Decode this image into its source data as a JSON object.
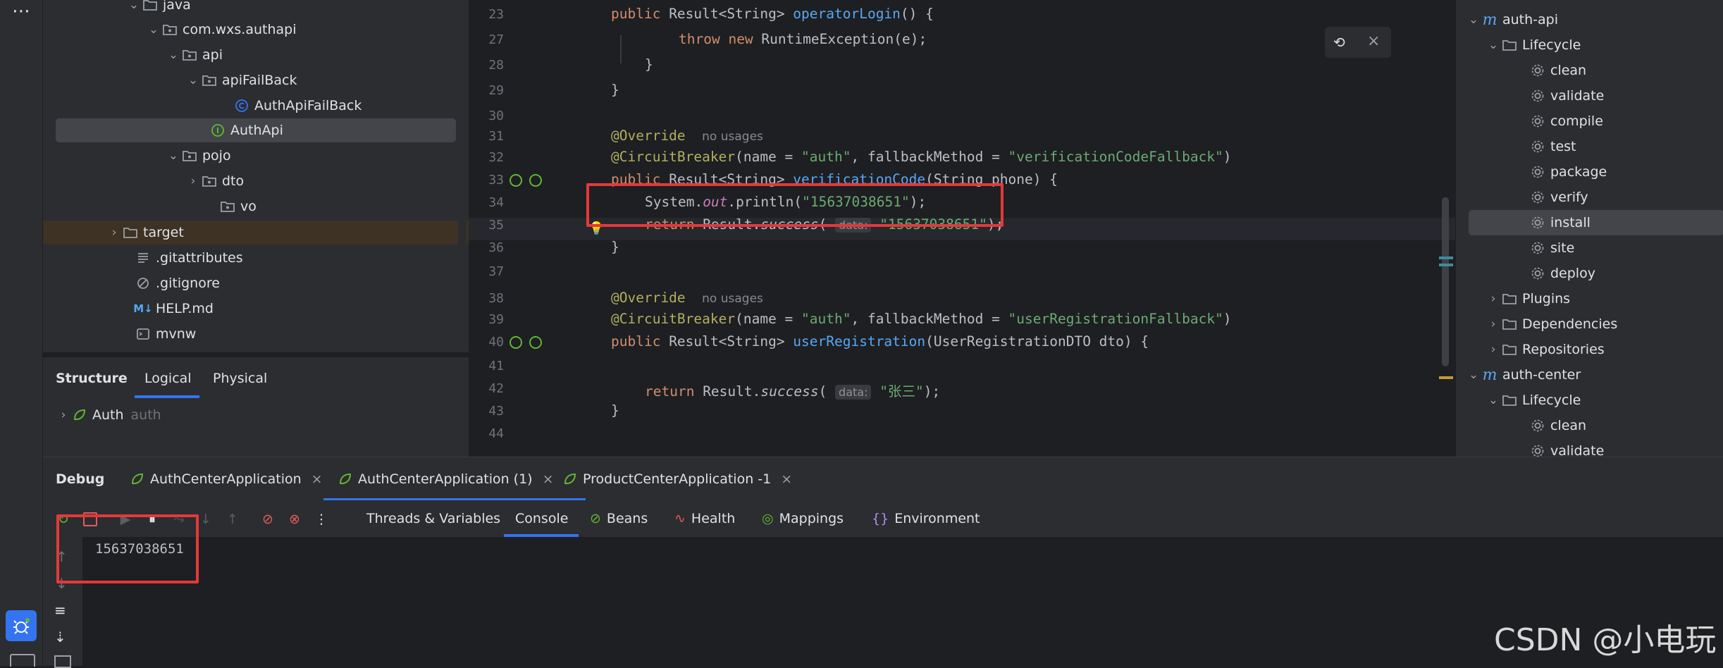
{
  "project_tree": [
    {
      "label": "java",
      "icon": "folder-icon",
      "expanded": true
    },
    {
      "label": "com.wxs.authapi",
      "icon": "package-icon",
      "expanded": true
    },
    {
      "label": "api",
      "icon": "package-icon",
      "expanded": true
    },
    {
      "label": "apiFailBack",
      "icon": "package-icon",
      "expanded": true
    },
    {
      "label": "AuthApiFailBack",
      "icon": "class-icon"
    },
    {
      "label": "AuthApi",
      "icon": "interface-icon",
      "selected": true
    },
    {
      "label": "pojo",
      "icon": "package-icon",
      "expanded": true
    },
    {
      "label": "dto",
      "icon": "package-icon",
      "expanded": false
    },
    {
      "label": "vo",
      "icon": "package-icon"
    },
    {
      "label": "target",
      "icon": "folder-icon",
      "expanded": false
    },
    {
      "label": ".gitattributes",
      "icon": "text-file-icon"
    },
    {
      "label": ".gitignore",
      "icon": "ignore-file-icon"
    },
    {
      "label": "HELP.md",
      "icon": "markdown-icon"
    },
    {
      "label": "mvnw",
      "icon": "shell-icon"
    }
  ],
  "structure": {
    "title": "Structure",
    "tabs": [
      "Logical",
      "Physical"
    ],
    "active_tab": "Logical",
    "root": {
      "label": "Auth",
      "hint": "auth"
    }
  },
  "editor": {
    "lines": [
      {
        "n": "23",
        "text": "public Result<String> operatorLogin() {"
      },
      {
        "n": "27",
        "text": "throw new RuntimeException(e);"
      },
      {
        "n": "28",
        "text": "}"
      },
      {
        "n": "29",
        "text": "}"
      },
      {
        "n": "30",
        "text": ""
      },
      {
        "n": "31",
        "text": "@Override",
        "hint": "no usages"
      },
      {
        "n": "32",
        "text": "@CircuitBreaker(name = \"auth\", fallbackMethod = \"verificationCodeFallback\")"
      },
      {
        "n": "33",
        "text": "public Result<String> verificationCode(String phone) {"
      },
      {
        "n": "34",
        "text": "System.out.println(\"15637038651\");"
      },
      {
        "n": "35",
        "text": "return Result.success( data: \"15637038651\");"
      },
      {
        "n": "36",
        "text": "}"
      },
      {
        "n": "37",
        "text": ""
      },
      {
        "n": "38",
        "text": "@Override",
        "hint": "no usages"
      },
      {
        "n": "39",
        "text": "@CircuitBreaker(name = \"auth\", fallbackMethod = \"userRegistrationFallback\")"
      },
      {
        "n": "40",
        "text": "public Result<String> userRegistration(UserRegistrationDTO dto) {"
      },
      {
        "n": "41",
        "text": ""
      },
      {
        "n": "42",
        "text": "return Result.success( data: \"张三\");"
      },
      {
        "n": "43",
        "text": "}"
      },
      {
        "n": "44",
        "text": ""
      }
    ],
    "inlay_label": "data:",
    "printed_value": "\"15637038651\"",
    "zh_value": "\"张三\""
  },
  "maven": {
    "modules": [
      {
        "name": "auth-api",
        "lifecycle_label": "Lifecycle",
        "phases": [
          "clean",
          "validate",
          "compile",
          "test",
          "package",
          "verify",
          "install",
          "site",
          "deploy"
        ],
        "selected": "install",
        "other_nodes": [
          "Plugins",
          "Dependencies",
          "Repositories"
        ]
      },
      {
        "name": "auth-center",
        "lifecycle_label": "Lifecycle",
        "phases": [
          "clean",
          "validate"
        ]
      }
    ]
  },
  "debug": {
    "title": "Debug",
    "sessions": [
      "AuthCenterApplication",
      "AuthCenterApplication (1)",
      "ProductCenterApplication -1"
    ],
    "active_session": "AuthCenterApplication (1)",
    "tabs": [
      "Threads & Variables",
      "Console",
      "Beans",
      "Health",
      "Mappings",
      "Environment"
    ],
    "active_tab": "Console",
    "console_output": "15637038651"
  },
  "watermark": "CSDN @小电玩",
  "colors": {
    "accent": "#3574f0",
    "highlight_box": "#e53838",
    "selection": "#43454a"
  }
}
